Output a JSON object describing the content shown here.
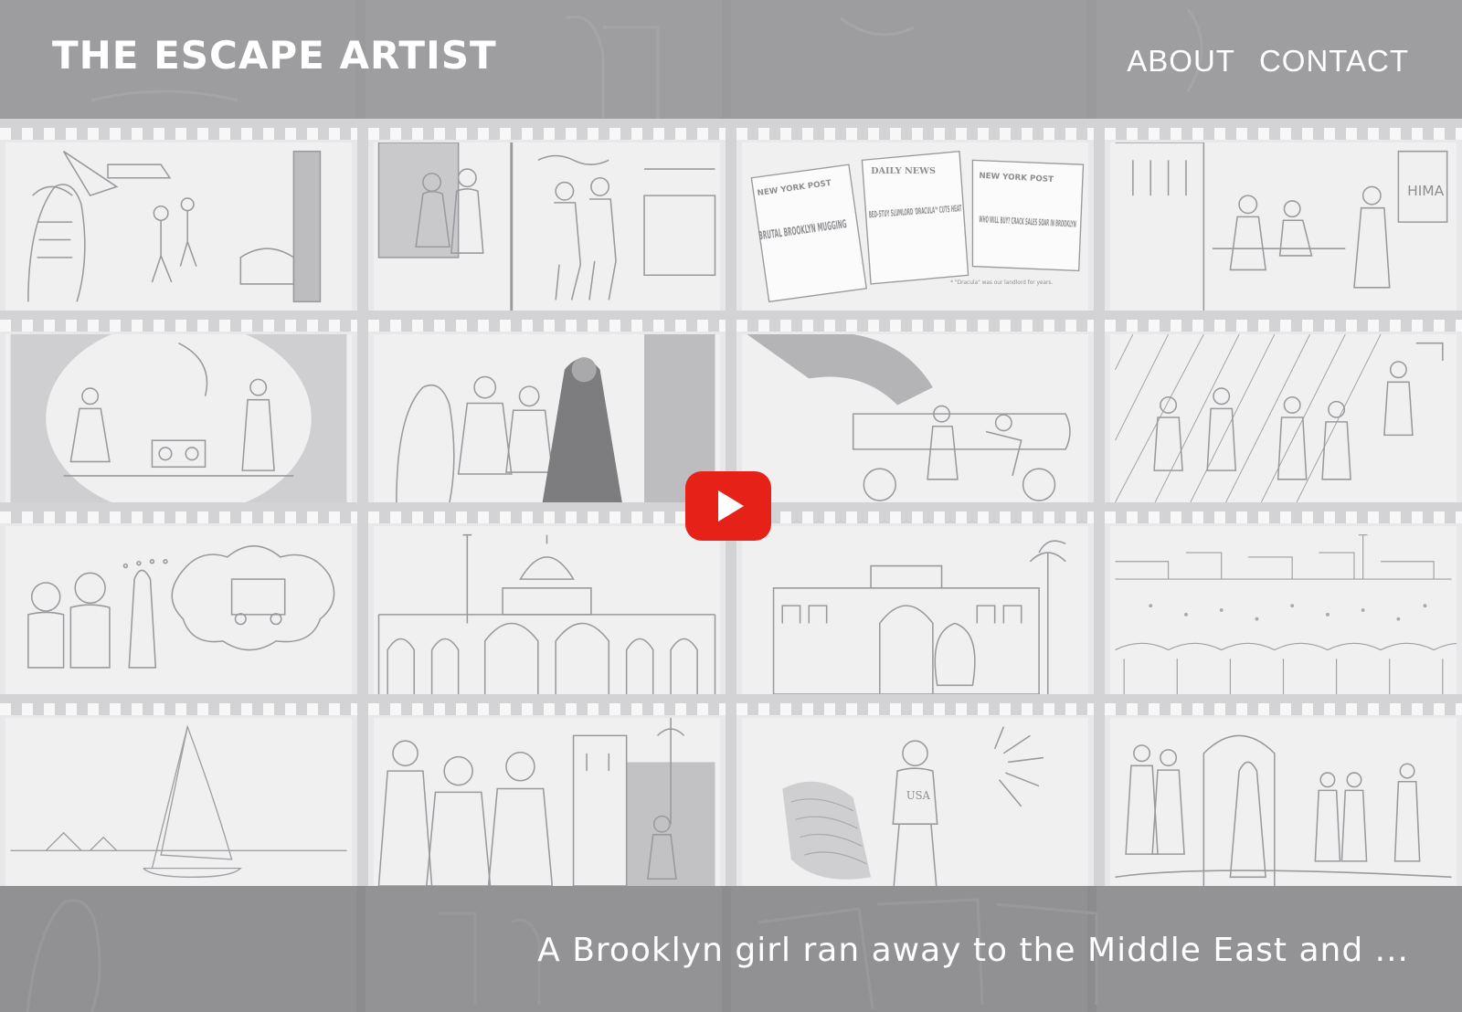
{
  "header": {
    "title": "THE ESCAPE ARTIST",
    "nav": [
      {
        "label": "ABOUT"
      },
      {
        "label": "CONTACT"
      }
    ]
  },
  "panels": [
    {
      "scene": "street-corner"
    },
    {
      "scene": "sidewalk-group"
    },
    {
      "scene": "newspapers",
      "texts": [
        "NEW YORK POST",
        "BRUTAL BROOKLYN MUGGING",
        "DAILY NEWS",
        "BED-STUY SLUMLORD 'DRACULA'* CUTS HEAT",
        "NEW YORK POST",
        "WHO WILL BUY? CRACK SALES SOAR IN BROOKLYN",
        "* \"Dracula\" was our landlord for years."
      ]
    },
    {
      "scene": "storefront",
      "texts": [
        "HIMA"
      ]
    },
    {
      "scene": "subway-car"
    },
    {
      "scene": "subway-seats"
    },
    {
      "scene": "police-arrest"
    },
    {
      "scene": "basketball-court"
    },
    {
      "scene": "daydream"
    },
    {
      "scene": "mosque"
    },
    {
      "scene": "egyptian-museum"
    },
    {
      "scene": "market-square"
    },
    {
      "scene": "felucca-sailboat"
    },
    {
      "scene": "crowd-street"
    },
    {
      "scene": "usa-heroine",
      "texts": [
        "USA"
      ]
    },
    {
      "scene": "soldiers-doorway"
    }
  ],
  "video": {
    "icon": "play-icon",
    "color": "#e62117"
  },
  "footer": {
    "tagline": "A Brooklyn girl ran away to the Middle East and ..."
  }
}
